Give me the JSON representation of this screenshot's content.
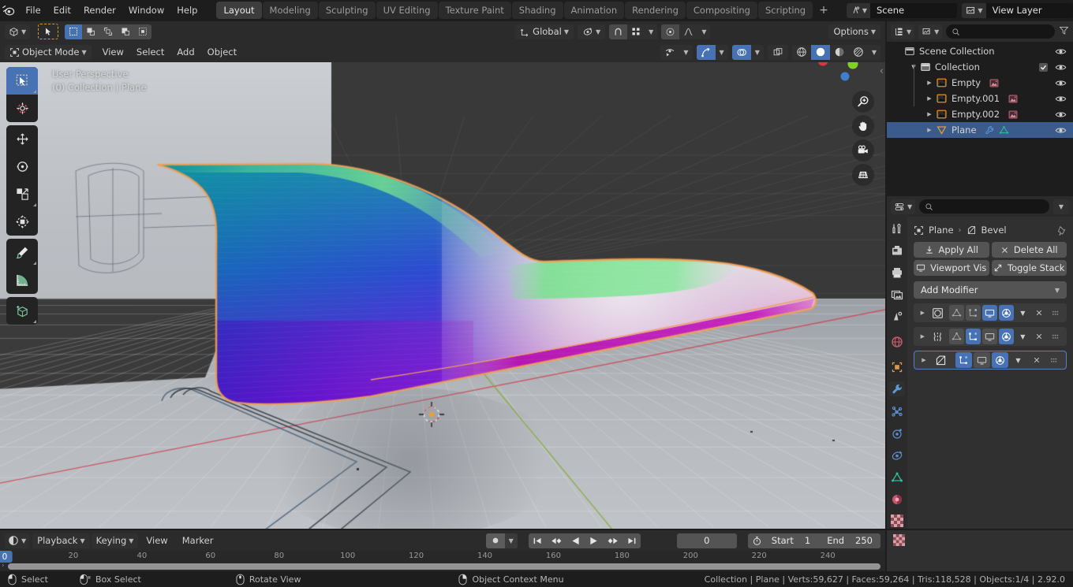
{
  "topbar": {
    "logo_icon": "blender-logo-icon",
    "menus": [
      "File",
      "Edit",
      "Render",
      "Window",
      "Help"
    ],
    "workspace_tabs": [
      {
        "label": "Layout",
        "active": true
      },
      {
        "label": "Modeling",
        "active": false
      },
      {
        "label": "Sculpting",
        "active": false
      },
      {
        "label": "UV Editing",
        "active": false
      },
      {
        "label": "Texture Paint",
        "active": false
      },
      {
        "label": "Shading",
        "active": false
      },
      {
        "label": "Animation",
        "active": false
      },
      {
        "label": "Rendering",
        "active": false
      },
      {
        "label": "Compositing",
        "active": false
      },
      {
        "label": "Scripting",
        "active": false
      }
    ],
    "add_workspace_label": "+",
    "scene": {
      "icon": "scene-icon",
      "name": "Scene",
      "copy_icon": "duplicate-icon",
      "close_icon": "x-icon"
    },
    "view_layer": {
      "icon": "view-layer-icon",
      "name": "View Layer",
      "copy_icon": "duplicate-icon",
      "close_icon": "x-icon"
    }
  },
  "viewport": {
    "header": {
      "editor_type_icon": "editor-type-3dview-icon",
      "select_tool_icon": "cursor-arrow-icon",
      "select_modes": [
        "select-set-icon",
        "select-extend-icon",
        "select-subtract-icon",
        "select-invert-icon",
        "select-intersect-icon"
      ],
      "transform_orientation": "Global",
      "pivot_icon": "pivot-point-icon",
      "snap_icon": "snap-magnet-icon",
      "snap_to_icon": "snap-increment-icon",
      "proportional_icon": "proportional-edit-icon",
      "falloff_icon": "falloff-curve-icon",
      "options_label": "Options"
    },
    "subheader": {
      "mode": "Object Mode",
      "menus": [
        "View",
        "Select",
        "Add",
        "Object"
      ],
      "visibility_icon": "object-visibility-icon",
      "gizmo_icon": "gizmo-icon",
      "overlays_icon": "overlays-icon",
      "xray_icon": "xray-toggle-icon",
      "shading_modes": [
        "wireframe-shading-icon",
        "solid-shading-icon",
        "material-preview-icon",
        "rendered-shading-icon"
      ],
      "shading_active": "solid-shading-icon"
    },
    "overlay_text_line1": "User Perspective",
    "overlay_text_line2": "(0) Collection | Plane",
    "toolbar_tools": [
      {
        "name": "tweak-select-tool",
        "icon": "cursor-arrow-icon",
        "active": true
      },
      {
        "name": "cursor-tool",
        "icon": "3d-cursor-icon",
        "active": false
      },
      {
        "name": "move-tool",
        "icon": "move-arrows-icon",
        "active": false
      },
      {
        "name": "rotate-tool",
        "icon": "rotate-icon",
        "active": false
      },
      {
        "name": "scale-tool",
        "icon": "scale-icon",
        "active": false
      },
      {
        "name": "transform-tool",
        "icon": "transform-icon",
        "active": false
      },
      {
        "name": "annotate-tool",
        "icon": "pencil-icon",
        "active": false
      },
      {
        "name": "measure-tool",
        "icon": "ruler-icon",
        "active": false
      },
      {
        "name": "add-cube-tool",
        "icon": "add-cube-icon",
        "active": false
      }
    ],
    "gizmo_axes": [
      {
        "label": "X",
        "color": "#cc4452"
      },
      {
        "label": "Y",
        "color": "#6ead2b"
      },
      {
        "label": "Z",
        "color": "#2a7fd4"
      }
    ],
    "nav_buttons": [
      "zoom-icon",
      "pan-hand-icon",
      "camera-view-icon",
      "toggle-perspective-icon"
    ],
    "colors": {
      "world_background": "#393939",
      "floor_plane": "#b9bcc0",
      "x_axis_line": "#cc4452",
      "y_axis_line": "#7dad29",
      "selection_outline": "#f0a056"
    }
  },
  "outliner": {
    "display_mode_icon": "outliner-display-mode-icon",
    "filter_id_icon": "id-type-filter-icon",
    "search_placeholder": "",
    "search_icon": "search-icon",
    "filter_icon": "filter-funnel-icon",
    "rows": [
      {
        "label": "Scene Collection",
        "icon": "scene-collection-icon",
        "depth": 0,
        "expand": "",
        "selected": false,
        "eye": true,
        "checkbox": false
      },
      {
        "label": "Collection",
        "icon": "collection-icon",
        "depth": 1,
        "expand": "down",
        "selected": false,
        "eye": true,
        "checkbox": true
      },
      {
        "label": "Empty",
        "icon": "image-empty-icon",
        "depth": 2,
        "expand": "right",
        "selected": false,
        "eye": true,
        "checkbox": false,
        "data_icon": "image-data-icon"
      },
      {
        "label": "Empty.001",
        "icon": "image-empty-icon",
        "depth": 2,
        "expand": "right",
        "selected": false,
        "eye": true,
        "checkbox": false,
        "data_icon": "image-data-icon"
      },
      {
        "label": "Empty.002",
        "icon": "image-empty-icon",
        "depth": 2,
        "expand": "right",
        "selected": false,
        "eye": true,
        "checkbox": false,
        "data_icon": "image-data-icon"
      },
      {
        "label": "Plane",
        "icon": "mesh-object-icon",
        "depth": 2,
        "expand": "right",
        "selected": true,
        "eye": true,
        "checkbox": false,
        "data_icon": "modifier-wrench-icon",
        "data_icon2": "mesh-data-icon"
      }
    ]
  },
  "properties": {
    "editor_icon": "properties-editor-icon",
    "search_placeholder": "",
    "tabs": [
      {
        "name": "tool-tab",
        "icon": "tool-screwdriver-wrench-icon",
        "active": false
      },
      {
        "name": "render-tab",
        "icon": "render-camera-icon",
        "active": false
      },
      {
        "name": "output-tab",
        "icon": "output-printer-icon",
        "active": false
      },
      {
        "name": "view-layer-tab",
        "icon": "view-layer-images-icon",
        "active": false
      },
      {
        "name": "scene-tab",
        "icon": "scene-cone-icon",
        "active": false
      },
      {
        "name": "world-tab",
        "icon": "world-globe-icon",
        "active": false
      },
      {
        "name": "object-tab",
        "icon": "object-square-icon",
        "active": false
      },
      {
        "name": "modifier-tab",
        "icon": "modifier-wrench-icon",
        "active": true
      },
      {
        "name": "particles-tab",
        "icon": "particles-icon",
        "active": false
      },
      {
        "name": "physics-tab",
        "icon": "physics-orbit-icon",
        "active": false
      },
      {
        "name": "constraints-tab",
        "icon": "object-constraints-icon",
        "active": false
      },
      {
        "name": "data-tab",
        "icon": "mesh-data-triangle-icon",
        "active": false
      },
      {
        "name": "material-tab",
        "icon": "material-sphere-icon",
        "active": false
      },
      {
        "name": "texture-tab",
        "icon": "texture-checker-icon",
        "active": false
      }
    ],
    "breadcrumb": {
      "object_icon": "object-square-icon",
      "object_name": "Plane",
      "separator": "›",
      "modifier_icon": "bevel-modifier-icon",
      "modifier_name": "Bevel",
      "pin_icon": "pin-icon"
    },
    "buttons": {
      "apply_all": {
        "label": "Apply All",
        "icon": "download-apply-icon"
      },
      "delete_all": {
        "label": "Delete All",
        "icon": "x-icon"
      },
      "viewport_vis": {
        "label": "Viewport Vis",
        "icon": "display-monitor-icon"
      },
      "toggle_stack": {
        "label": "Toggle Stack",
        "icon": "expand-arrows-icon"
      }
    },
    "add_modifier_label": "Add Modifier",
    "add_modifier_caret": "chevron-down-icon",
    "modifier_stack": [
      {
        "name": "subdivision-surface-modifier",
        "icon": "subsurf-circle-icon",
        "expand_icon": "chevron-right-icon",
        "toggles": [
          {
            "name": "on-cage-toggle",
            "icon": "edit-mode-cage-icon",
            "state": "dim"
          },
          {
            "name": "edit-mode-display-toggle",
            "icon": "edit-mode-icon",
            "state": "dim"
          },
          {
            "name": "realtime-display-toggle",
            "icon": "display-monitor-icon",
            "state": "on"
          },
          {
            "name": "render-display-toggle",
            "icon": "camera-icon",
            "state": "on"
          }
        ],
        "menu_icon": "chevron-down-icon",
        "close_icon": "x-icon",
        "grip_icon": "drag-grip-icon",
        "selected": false
      },
      {
        "name": "simple-deform-modifier",
        "icon": "simple-deform-icon",
        "expand_icon": "chevron-right-icon",
        "toggles": [
          {
            "name": "on-cage-toggle",
            "icon": "edit-mode-cage-icon",
            "state": "dim"
          },
          {
            "name": "edit-mode-display-toggle",
            "icon": "edit-mode-icon",
            "state": "on"
          },
          {
            "name": "realtime-display-toggle",
            "icon": "display-monitor-icon",
            "state": "off"
          },
          {
            "name": "render-display-toggle",
            "icon": "camera-icon",
            "state": "on"
          }
        ],
        "menu_icon": "chevron-down-icon",
        "close_icon": "x-icon",
        "grip_icon": "drag-grip-icon",
        "selected": false
      },
      {
        "name": "bevel-modifier",
        "icon": "bevel-modifier-icon",
        "expand_icon": "chevron-right-icon",
        "toggles": [
          {
            "name": "edit-mode-display-toggle",
            "icon": "edit-mode-icon",
            "state": "on"
          },
          {
            "name": "realtime-display-toggle",
            "icon": "display-monitor-icon",
            "state": "off"
          },
          {
            "name": "render-display-toggle",
            "icon": "camera-icon",
            "state": "on"
          }
        ],
        "menu_icon": "chevron-down-icon",
        "close_icon": "x-icon",
        "grip_icon": "drag-grip-icon",
        "selected": true
      }
    ]
  },
  "timeline": {
    "editor_icon": "timeline-editor-icon",
    "menus": [
      "Playback",
      "Keying",
      "View",
      "Marker"
    ],
    "record_icon": "record-dot-icon",
    "transport": [
      "jump-to-start-icon",
      "jump-to-prev-keyframe-icon",
      "play-reverse-icon",
      "play-icon",
      "jump-to-next-keyframe-icon",
      "jump-to-end-icon"
    ],
    "current_frame": "0",
    "timer_icon": "stopwatch-icon",
    "start_label": "Start",
    "start_value": "1",
    "end_label": "End",
    "end_value": "250",
    "ruler_ticks": [
      "20",
      "40",
      "60",
      "80",
      "100",
      "120",
      "140",
      "160",
      "180",
      "200",
      "220",
      "240"
    ],
    "playhead_label": "0"
  },
  "statusbar": {
    "hints": [
      {
        "icon": "mouse-left-icon",
        "label": "Select"
      },
      {
        "icon": "mouse-left-drag-icon",
        "label": "Box Select"
      },
      {
        "icon": "mouse-middle-icon",
        "label": "Rotate View"
      },
      {
        "icon": "mouse-right-icon",
        "label": "Object Context Menu"
      }
    ],
    "scene_stats": "Collection | Plane | Verts:59,627 | Faces:59,264 | Tris:118,528 | Objects:1/4 | 2.92.0"
  }
}
